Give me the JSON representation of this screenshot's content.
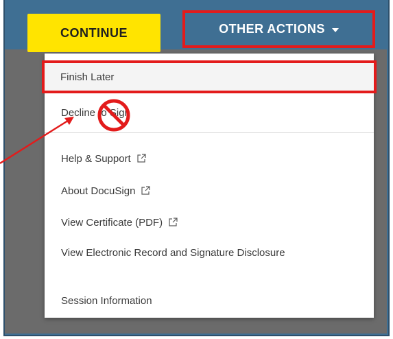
{
  "header": {
    "continue_label": "CONTINUE",
    "other_actions_label": "OTHER ACTIONS"
  },
  "menu": {
    "items": [
      {
        "label": "Finish Later"
      },
      {
        "label": "Decline to Sign"
      },
      {
        "label": "Help & Support",
        "external": true
      },
      {
        "label": "About DocuSign",
        "external": true
      },
      {
        "label": "View Certificate (PDF)",
        "external": true
      },
      {
        "label": "View Electronic Record and Signature Disclosure"
      },
      {
        "label": "Session Information"
      }
    ]
  },
  "colors": {
    "frame_blue": "#3f6f93",
    "continue_yellow": "#ffe400",
    "highlight_red": "#e31b1b",
    "menu_bg": "#ffffff"
  },
  "icons": {
    "external_link": "external-link-icon",
    "prohibited": "prohibited-icon",
    "caret": "caret-down-icon"
  }
}
